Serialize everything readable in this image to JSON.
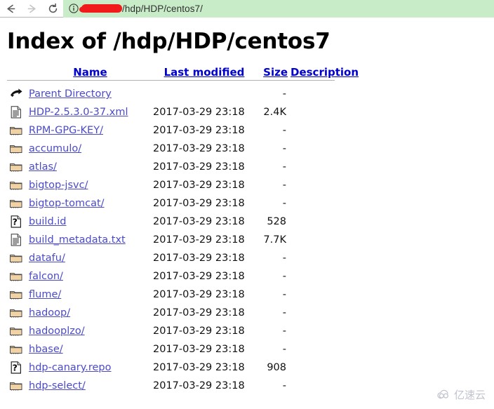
{
  "browser": {
    "back_label": "Back",
    "forward_label": "Forward",
    "reload_label": "Reload",
    "site_info_label": "Site information",
    "url_redacted_label": "redacted-host",
    "url_visible_text": "/hdp/HDP/centos7/",
    "omnibox_bg": "#c8ecc8",
    "redaction_color": "#f21b1b"
  },
  "page": {
    "title": "Index of /hdp/HDP/centos7",
    "link_color": "#0000cd",
    "row_link_color": "#4b4bc8"
  },
  "table": {
    "headers": {
      "name": "Name",
      "last_modified": "Last modified",
      "size": "Size",
      "description": "Description"
    },
    "rows": [
      {
        "icon": "parent-directory-icon",
        "name": "Parent Directory",
        "date": "",
        "size": "-",
        "desc": ""
      },
      {
        "icon": "text-document-icon",
        "name": "HDP-2.5.3.0-37.xml",
        "date": "2017-03-29 23:18",
        "size": "2.4K",
        "desc": ""
      },
      {
        "icon": "folder-icon",
        "name": "RPM-GPG-KEY/",
        "date": "2017-03-29 23:18",
        "size": "-",
        "desc": ""
      },
      {
        "icon": "folder-icon",
        "name": "accumulo/",
        "date": "2017-03-29 23:18",
        "size": "-",
        "desc": ""
      },
      {
        "icon": "folder-icon",
        "name": "atlas/",
        "date": "2017-03-29 23:18",
        "size": "-",
        "desc": ""
      },
      {
        "icon": "folder-icon",
        "name": "bigtop-jsvc/",
        "date": "2017-03-29 23:18",
        "size": "-",
        "desc": ""
      },
      {
        "icon": "folder-icon",
        "name": "bigtop-tomcat/",
        "date": "2017-03-29 23:18",
        "size": "-",
        "desc": ""
      },
      {
        "icon": "unknown-file-icon",
        "name": "build.id",
        "date": "2017-03-29 23:18",
        "size": "528",
        "desc": ""
      },
      {
        "icon": "text-document-icon",
        "name": "build_metadata.txt",
        "date": "2017-03-29 23:18",
        "size": "7.7K",
        "desc": ""
      },
      {
        "icon": "folder-icon",
        "name": "datafu/",
        "date": "2017-03-29 23:18",
        "size": "-",
        "desc": ""
      },
      {
        "icon": "folder-icon",
        "name": "falcon/",
        "date": "2017-03-29 23:18",
        "size": "-",
        "desc": ""
      },
      {
        "icon": "folder-icon",
        "name": "flume/",
        "date": "2017-03-29 23:18",
        "size": "-",
        "desc": ""
      },
      {
        "icon": "folder-icon",
        "name": "hadoop/",
        "date": "2017-03-29 23:18",
        "size": "-",
        "desc": ""
      },
      {
        "icon": "folder-icon",
        "name": "hadooplzo/",
        "date": "2017-03-29 23:18",
        "size": "-",
        "desc": ""
      },
      {
        "icon": "folder-icon",
        "name": "hbase/",
        "date": "2017-03-29 23:18",
        "size": "-",
        "desc": ""
      },
      {
        "icon": "unknown-file-icon",
        "name": "hdp-canary.repo",
        "date": "2017-03-29 23:18",
        "size": "908",
        "desc": ""
      },
      {
        "icon": "folder-icon",
        "name": "hdp-select/",
        "date": "2017-03-29 23:18",
        "size": "-",
        "desc": ""
      }
    ]
  },
  "watermark": {
    "text": "亿速云"
  }
}
